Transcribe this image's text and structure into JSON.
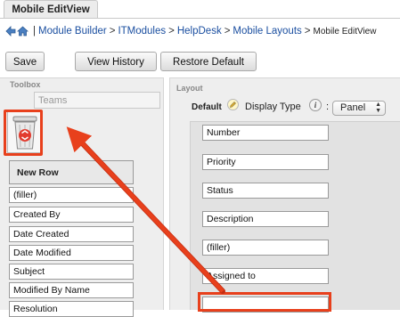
{
  "tab": {
    "label": "Mobile EditView"
  },
  "breadcrumb": {
    "items": [
      "Module Builder",
      "ITModules",
      "HelpDesk",
      "Mobile Layouts"
    ],
    "current": "Mobile EditView",
    "separator": ">",
    "leading_separator": "|"
  },
  "toolbar": {
    "save_label": "Save",
    "history_label": "View History",
    "restore_label": "Restore Default"
  },
  "toolbox": {
    "title": "Toolbox",
    "hidden_field": "Teams",
    "new_row_label": "New Row",
    "fields": [
      "(filler)",
      "Created By",
      "Date Created",
      "Date Modified",
      "Subject",
      "Modified By Name",
      "Resolution"
    ]
  },
  "layout": {
    "title": "Layout",
    "panel_label": "Default",
    "display_type_label": "Display Type",
    "display_type_value": "Panel",
    "fields": [
      "Number",
      "Priority",
      "Status",
      "Description",
      "(filler)",
      "Assigned to",
      ""
    ]
  },
  "colors": {
    "highlight": "#e8401c",
    "link": "#1b4fa0",
    "panel_bg": "#eeeeee"
  },
  "icons": [
    "back-arrow-icon",
    "home-icon",
    "trash-icon",
    "pencil-icon",
    "info-icon",
    "select-arrows-icon"
  ]
}
